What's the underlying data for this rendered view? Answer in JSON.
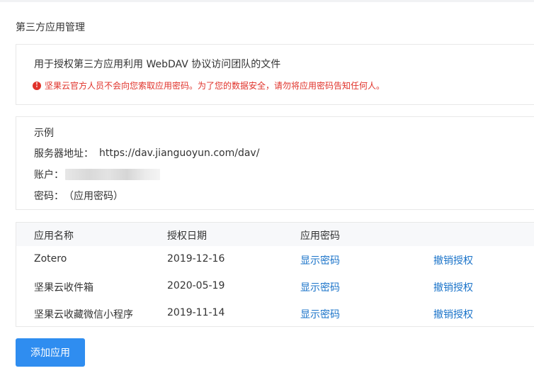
{
  "page": {
    "title": "第三方应用管理"
  },
  "intro": {
    "description": "用于授权第三方应用利用 WebDAV 协议访问团队的文件",
    "warning": "坚果云官方人员不会向您索取应用密码。为了您的数据安全，请勿将应用密码告知任何人。",
    "warning_icon": "exclamation-circle-icon",
    "warning_color": "#e0322a"
  },
  "example": {
    "heading": "示例",
    "server_label": "服务器地址：",
    "server_value": "https://dav.jianguoyun.com/dav/",
    "account_label": "账户：",
    "password_label": "密码：",
    "password_value": "（应用密码）"
  },
  "table": {
    "headers": [
      "应用名称",
      "授权日期",
      "应用密码"
    ],
    "rows": [
      {
        "name": "Zotero",
        "date": "2019-12-16",
        "show": "显示密码",
        "revoke": "撤销授权"
      },
      {
        "name": "坚果云收件箱",
        "date": "2020-05-19",
        "show": "显示密码",
        "revoke": "撤销授权"
      },
      {
        "name": "坚果云收藏微信小程序",
        "date": "2019-11-14",
        "show": "显示密码",
        "revoke": "撤销授权"
      }
    ],
    "link_color": "#1a73c9"
  },
  "actions": {
    "add_app_label": "添加应用",
    "accent_color": "#2f8df0"
  }
}
